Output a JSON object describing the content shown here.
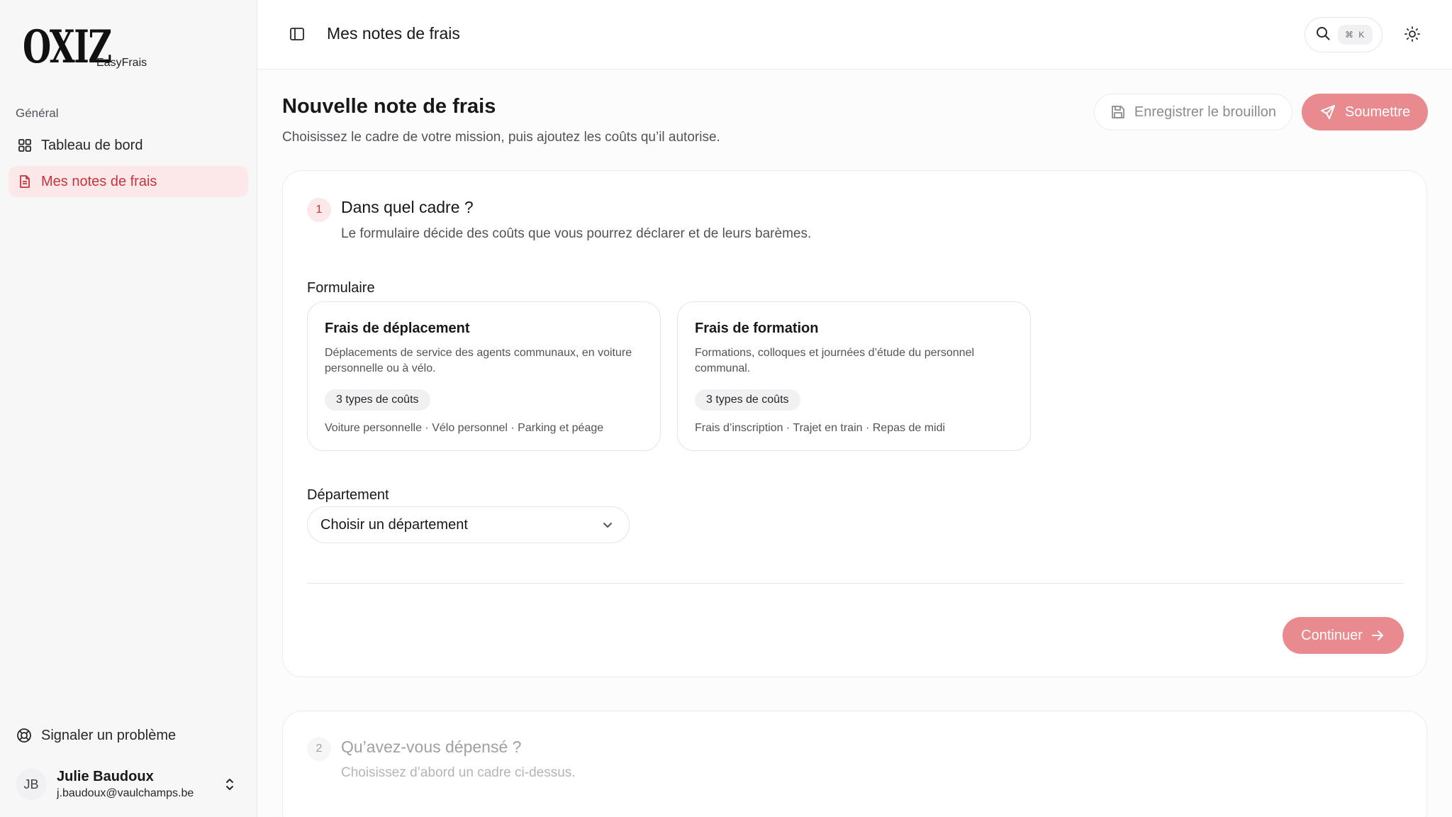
{
  "brand": {
    "logo_text": "OXIZ",
    "product": "EasyFrais"
  },
  "sidebar": {
    "section_label": "Général",
    "items": [
      {
        "label": "Tableau de bord",
        "icon": "dashboard-grid-icon",
        "active": false
      },
      {
        "label": "Mes notes de frais",
        "icon": "file-text-icon",
        "active": true
      }
    ],
    "report_label": "Signaler un problème",
    "user": {
      "initials": "JB",
      "name": "Julie Baudoux",
      "email": "j.baudoux@vaulchamps.be"
    }
  },
  "topbar": {
    "title": "Mes notes de frais",
    "search_shortcut": "⌘ K"
  },
  "page": {
    "title": "Nouvelle note de frais",
    "subtitle": "Choisissez le cadre de votre mission, puis ajoutez les coûts qu’il autorise.",
    "draft_label": "Enregistrer le brouillon",
    "submit_label": "Soumettre"
  },
  "step1": {
    "number": "1",
    "title": "Dans quel cadre ?",
    "subtitle": "Le formulaire décide des coûts que vous pourrez déclarer et de leurs barèmes.",
    "form_label": "Formulaire",
    "options": [
      {
        "title": "Frais de déplacement",
        "description": "Déplacements de service des agents communaux, en voiture personnelle ou à vélo.",
        "badge": "3 types de coûts",
        "types": "Voiture personnelle · Vélo personnel · Parking et péage"
      },
      {
        "title": "Frais de formation",
        "description": "Formations, colloques et journées d’étude du personnel communal.",
        "badge": "3 types de coûts",
        "types": "Frais d’inscription · Trajet en train · Repas de midi"
      }
    ],
    "department_label": "Département",
    "department_placeholder": "Choisir un département",
    "continue_label": "Continuer"
  },
  "step2": {
    "number": "2",
    "title": "Qu’avez-vous dépensé ?",
    "subtitle": "Choisissez d’abord un cadre ci-dessus."
  },
  "colors": {
    "accent": "#c8343e",
    "accent_soft": "#fde8e9",
    "button_disabled": "#e88a8e"
  }
}
